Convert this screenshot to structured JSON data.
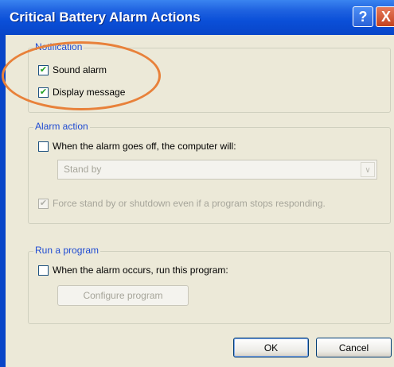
{
  "window": {
    "title": "Critical Battery Alarm Actions",
    "help_glyph": "?",
    "close_glyph": "X"
  },
  "notification": {
    "legend": "Notification",
    "sound_alarm": {
      "label": "Sound alarm",
      "checked": true
    },
    "display_message": {
      "label": "Display message",
      "checked": true
    }
  },
  "alarm_action": {
    "legend": "Alarm action",
    "when_alarm": {
      "label": "When the alarm goes off, the computer will:",
      "checked": false
    },
    "action_select": {
      "value": "Stand by",
      "arrow_glyph": "∨"
    },
    "force": {
      "label": "Force stand by or shutdown even if a program stops responding.",
      "checked": true,
      "enabled": false
    }
  },
  "run_program": {
    "legend": "Run a program",
    "when_occurs": {
      "label": "When the alarm occurs, run this program:",
      "checked": false
    },
    "configure_label": "Configure program"
  },
  "buttons": {
    "ok": "OK",
    "cancel": "Cancel"
  },
  "colors": {
    "title_bar": "#0A4FD8",
    "dialog_bg": "#ECE9D8",
    "legend_text": "#1F4BD2",
    "highlight": "#E8813A"
  }
}
